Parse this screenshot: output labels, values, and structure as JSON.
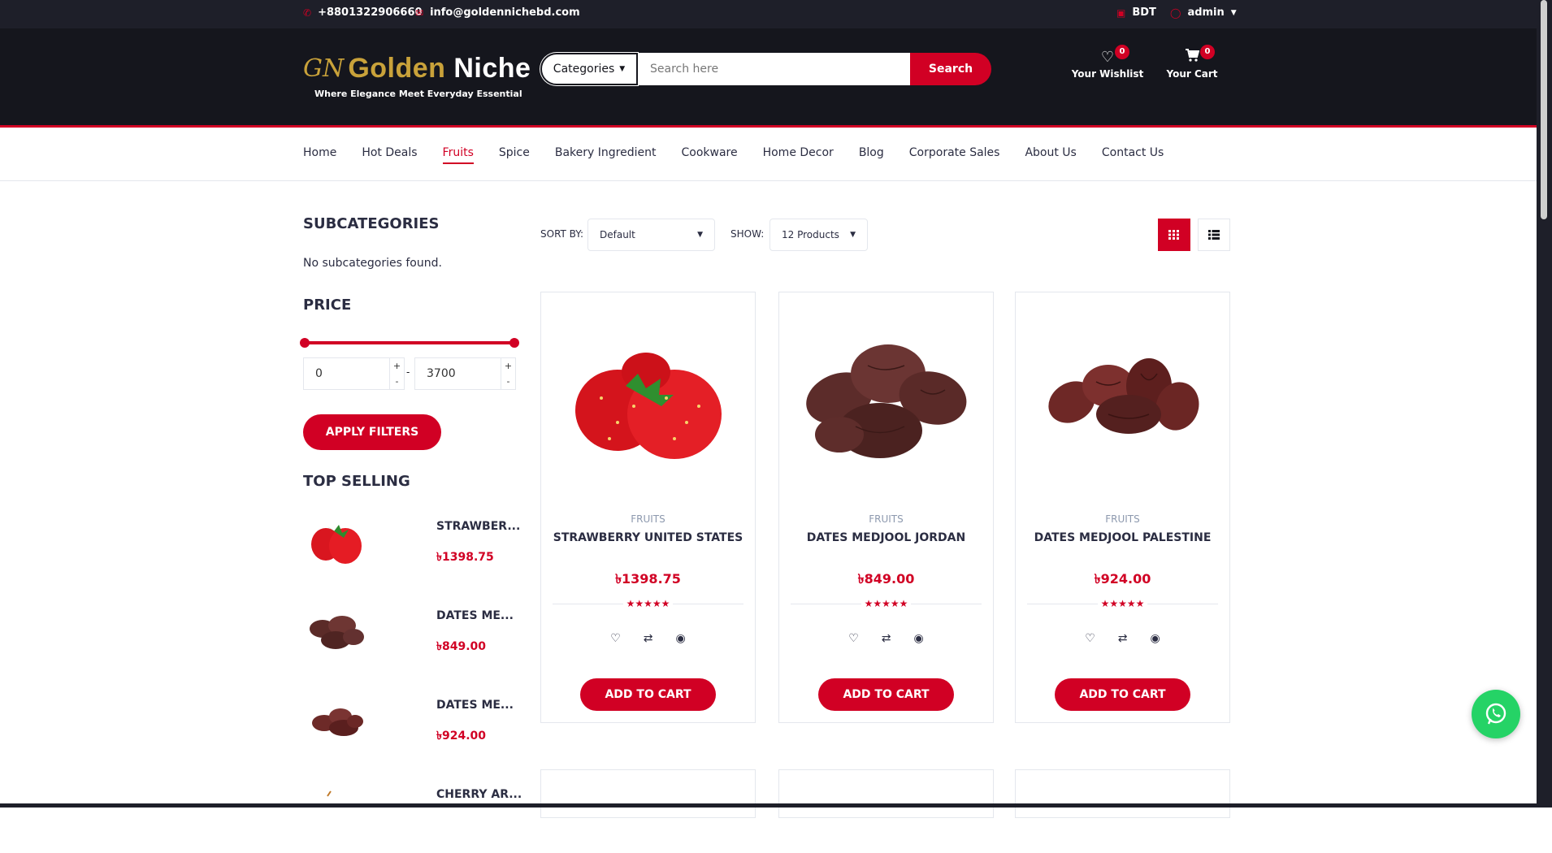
{
  "topbar": {
    "phone": "+8801322906660",
    "email": "info@goldennichebd.com",
    "currency": "BDT",
    "user": "admin"
  },
  "header": {
    "logo_mark": "GN",
    "logo_word1": "Golden",
    "logo_word2": "Niche",
    "tagline": "Where Elegance Meet Everyday Essential",
    "categories_label": "Categories",
    "search_placeholder": "Search here",
    "search_button": "Search",
    "wishlist_label": "Your Wishlist",
    "wishlist_count": "0",
    "cart_label": "Your Cart",
    "cart_count": "0"
  },
  "nav": {
    "items": [
      "Home",
      "Hot Deals",
      "Fruits",
      "Spice",
      "Bakery Ingredient",
      "Cookware",
      "Home Decor",
      "Blog",
      "Corporate Sales",
      "About Us",
      "Contact Us"
    ],
    "active": "Fruits"
  },
  "aside": {
    "subcategories_title": "SUBCATEGORIES",
    "no_subcategories": "No subcategories found.",
    "price_title": "PRICE",
    "price_min": "0",
    "price_max": "3700",
    "range_separator": "-",
    "apply_button": "APPLY FILTERS",
    "top_selling_title": "TOP SELLING",
    "top_selling": [
      {
        "name": "STRAWBER...",
        "price": "৳1398.75"
      },
      {
        "name": "DATES ME...",
        "price": "৳849.00"
      },
      {
        "name": "DATES ME...",
        "price": "৳924.00"
      },
      {
        "name": "CHERRY AR...",
        "price": ""
      }
    ]
  },
  "store": {
    "sort_label": "SORT BY:",
    "sort_value": "Default",
    "show_label": "SHOW:",
    "show_value": "12 Products"
  },
  "products": [
    {
      "category": "FRUITS",
      "name": "STRAWBERRY UNITED STATES",
      "price": "৳1398.75",
      "stars": "★★★★★",
      "add_label": "ADD TO CART"
    },
    {
      "category": "FRUITS",
      "name": "DATES MEDJOOL JORDAN",
      "price": "৳849.00",
      "stars": "★★★★★",
      "add_label": "ADD TO CART"
    },
    {
      "category": "FRUITS",
      "name": "DATES MEDJOOL PALESTINE",
      "price": "৳924.00",
      "stars": "★★★★★",
      "add_label": "ADD TO CART"
    }
  ],
  "colors": {
    "accent": "#d10024",
    "header_bg": "#15161d",
    "topbar_bg": "#1e1f29",
    "whatsapp": "#25d366"
  }
}
